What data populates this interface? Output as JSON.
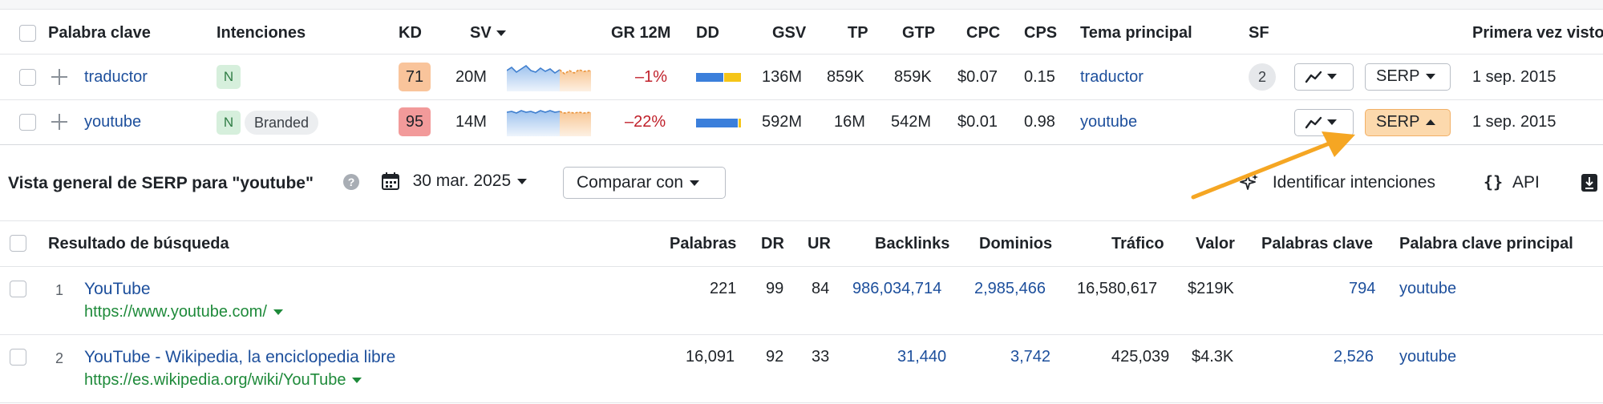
{
  "keywords_table": {
    "headers": {
      "keyword": "Palabra clave",
      "intents": "Intenciones",
      "kd": "KD",
      "sv": "SV",
      "gr12m": "GR 12M",
      "dd": "DD",
      "gsv": "GSV",
      "tp": "TP",
      "gtp": "GTP",
      "cpc": "CPC",
      "cps": "CPS",
      "parent_topic": "Tema principal",
      "sf": "SF",
      "first_seen": "Primera vez visto"
    },
    "rows": [
      {
        "keyword": "traductor",
        "intents": [
          "N"
        ],
        "kd": "71",
        "kd_color": "#f9c49b",
        "sv": "20M",
        "gr12m": "–1%",
        "gsv": "136M",
        "tp": "859K",
        "gtp": "859K",
        "cpc": "$0.07",
        "cps": "0.15",
        "parent_topic": "traductor",
        "sf": "2",
        "serp_label": "SERP",
        "first_seen": "1 sep. 2015"
      },
      {
        "keyword": "youtube",
        "intents": [
          "N",
          "Branded"
        ],
        "kd": "95",
        "kd_color": "#f29a9a",
        "sv": "14M",
        "gr12m": "–22%",
        "gsv": "592M",
        "tp": "16M",
        "gtp": "542M",
        "cpc": "$0.01",
        "cps": "0.98",
        "parent_topic": "youtube",
        "sf": "",
        "serp_label": "SERP",
        "first_seen": "1 sep. 2015"
      }
    ]
  },
  "serp_overview": {
    "title": "Vista general de SERP para \"youtube\"",
    "date": "30 mar. 2025",
    "compare_label": "Comparar con",
    "identify_label": "Identificar intenciones",
    "api_label": "API",
    "headers": {
      "result": "Resultado de búsqueda",
      "words": "Palabras",
      "dr": "DR",
      "ur": "UR",
      "backlinks": "Backlinks",
      "domains": "Dominios",
      "traffic": "Tráfico",
      "value": "Valor",
      "keywords": "Palabras clave",
      "top_keyword": "Palabra clave principal"
    },
    "rows": [
      {
        "pos": "1",
        "title": "YouTube",
        "url": "https://www.youtube.com/",
        "words": "221",
        "dr": "99",
        "ur": "84",
        "backlinks": "986,034,714",
        "domains": "2,985,466",
        "traffic": "16,580,617",
        "value": "$219K",
        "keywords": "794",
        "top_keyword": "youtube"
      },
      {
        "pos": "2",
        "title": "YouTube - Wikipedia, la enciclopedia libre",
        "url": "https://es.wikipedia.org/wiki/YouTube",
        "words": "16,091",
        "dr": "92",
        "ur": "33",
        "backlinks": "31,440",
        "domains": "3,742",
        "traffic": "425,039",
        "value": "$4.3K",
        "keywords": "2,526",
        "top_keyword": "youtube"
      }
    ]
  },
  "colors": {
    "link": "#1d4f9c",
    "url_green": "#1e8a3a",
    "negative_red": "#c0202a",
    "serp_active": "#fcd9ad",
    "annotation_arrow": "#f5a623"
  }
}
